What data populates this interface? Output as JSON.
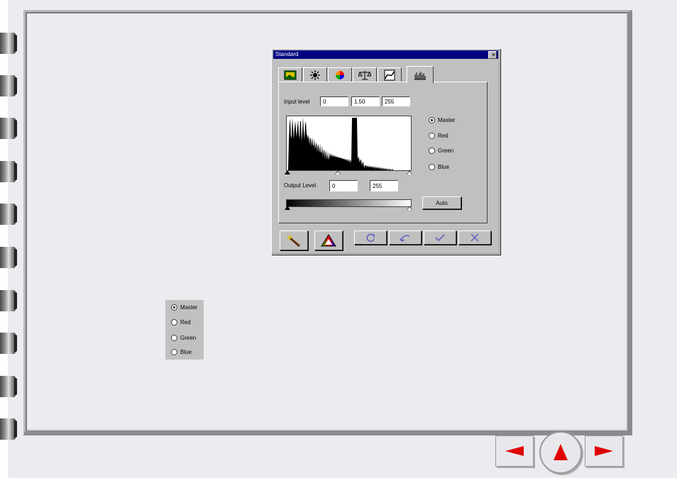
{
  "dialog": {
    "title": "Standard",
    "close_glyph": "✕",
    "tabs": [
      {
        "icon": "image-icon"
      },
      {
        "icon": "brightness-icon"
      },
      {
        "icon": "color-wheel-icon"
      },
      {
        "icon": "balance-icon"
      },
      {
        "icon": "curve-icon"
      },
      {
        "icon": "histogram-icon",
        "active": true
      }
    ],
    "input_level_label": "Input level",
    "input_values": [
      "0",
      "1.50",
      "255"
    ],
    "output_level_label": "Output Level",
    "output_values": [
      "0",
      "255"
    ],
    "channels": [
      {
        "label": "Master",
        "selected": true
      },
      {
        "label": "Red",
        "selected": false
      },
      {
        "label": "Green",
        "selected": false
      },
      {
        "label": "Blue",
        "selected": false
      }
    ],
    "auto_label": "Auto",
    "bottom_buttons": [
      "magic-wand-icon",
      "color-triangle-icon",
      "reset-icon",
      "undo-icon",
      "ok-check-icon",
      "cancel-x-icon"
    ]
  },
  "channel_box": {
    "items": [
      "Master",
      "Red",
      "Green",
      "Blue"
    ],
    "selected": "Master"
  },
  "nav": {
    "prev": "previous-page-icon",
    "home": "home-icon",
    "next": "next-page-icon",
    "accent": "#e00000"
  }
}
